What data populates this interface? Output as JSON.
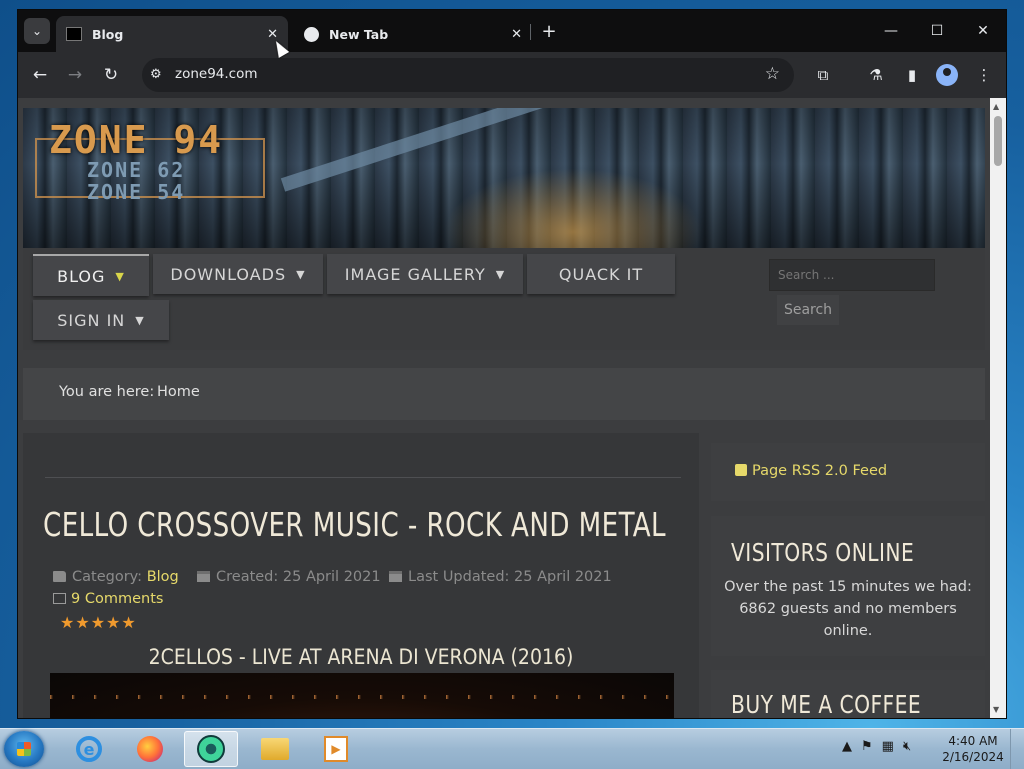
{
  "browser": {
    "tabs": [
      {
        "title": "Blog",
        "active": true
      },
      {
        "title": "New Tab",
        "active": false
      }
    ],
    "url": "zone94.com",
    "window_controls": {
      "minimize": "—",
      "maximize": "☐",
      "close": "✕"
    }
  },
  "site": {
    "logo": {
      "main": "ZONE 94",
      "line2": "ZONE 62",
      "line3": "ZONE 54"
    },
    "menu": [
      {
        "label": "BLOG",
        "has_dropdown": true,
        "active": true
      },
      {
        "label": "DOWNLOADS",
        "has_dropdown": true
      },
      {
        "label": "IMAGE GALLERY",
        "has_dropdown": true
      },
      {
        "label": "QUACK IT",
        "has_dropdown": false
      },
      {
        "label": "SIGN IN",
        "has_dropdown": true
      }
    ],
    "search": {
      "placeholder": "Search ...",
      "button": "Search"
    },
    "breadcrumb": {
      "label": "You are here:",
      "current": "Home"
    },
    "article": {
      "title": "CELLO CROSSOVER MUSIC - ROCK AND METAL",
      "category_label": "Category:",
      "category": "Blog",
      "created": "Created: 25 April 2021",
      "updated": "Last Updated: 25 April 2021",
      "comments": "9 Comments",
      "rating": "★★★★★",
      "subtitle": "2CELLOS - LIVE AT ARENA DI VERONA (2016)"
    },
    "sidebar": {
      "rss": "Page RSS 2.0 Feed",
      "visitors_title": "VISITORS ONLINE",
      "visitors_text": "Over the past 15 minutes we had: 6862 guests and no members online.",
      "coffee_title": "BUY ME A COFFEE"
    }
  },
  "taskbar": {
    "clock_time": "4:40 AM",
    "clock_date": "2/16/2024"
  },
  "colors": {
    "link": "#e6d96a",
    "accent_star": "#f09a2e",
    "taskbar": "#9ab7d0"
  }
}
